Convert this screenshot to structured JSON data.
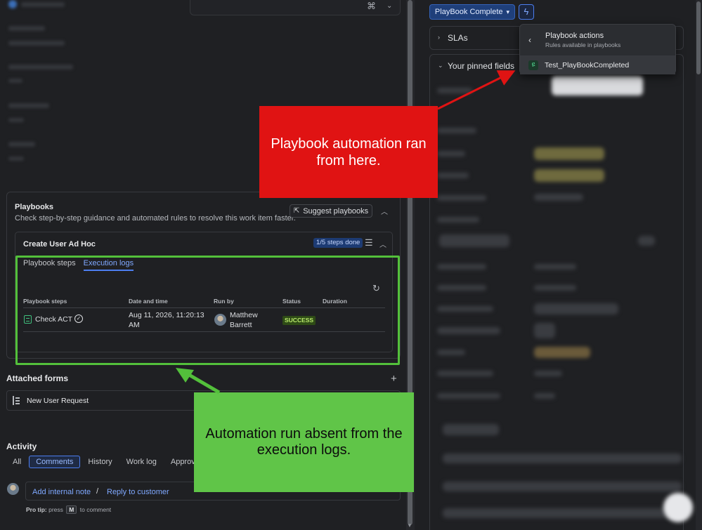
{
  "playbooks": {
    "title": "Playbooks",
    "description": "Check step-by-step guidance and automated rules to resolve this work item faster.",
    "suggest_label": "Suggest playbooks",
    "playbook_name": "Create User Ad Hoc",
    "steps_badge": "1/5 steps done",
    "tabs": [
      "Playbook steps",
      "Execution logs"
    ],
    "table": {
      "headers": [
        "Playbook steps",
        "Date and time",
        "Run by",
        "Status",
        "Duration"
      ],
      "rows": [
        {
          "step": "Check ACT",
          "datetime_line1": "Aug 11, 2026, 11:20:13",
          "datetime_line2": "AM",
          "run_by_line1": "Matthew",
          "run_by_line2": "Barrett",
          "status": "SUCCESS",
          "duration": ""
        }
      ]
    }
  },
  "attached_forms": {
    "title": "Attached forms",
    "items": [
      "New User Request"
    ]
  },
  "activity": {
    "title": "Activity",
    "tabs": [
      "All",
      "Comments",
      "History",
      "Work log",
      "Approval"
    ],
    "active_tab": "Comments",
    "add_internal_note": "Add internal note",
    "separator": "/",
    "reply_to_customer": "Reply to customer",
    "protip_label": "Pro tip:",
    "protip_press": "press",
    "protip_key": "M",
    "protip_rest": "to comment"
  },
  "right_panel": {
    "status_button": "PlayBook Complete",
    "accordions": [
      "SLAs",
      "Your pinned fields"
    ],
    "dropdown": {
      "title": "Playbook actions",
      "subtitle": "Rules available in playbooks",
      "item": "Test_PlayBookCompleted"
    }
  },
  "annotations": {
    "red_note": "Playbook automation ran from here.",
    "green_note": "Automation run absent from the execution logs.",
    "red_color": "#e01313",
    "green_color": "#60c548"
  }
}
